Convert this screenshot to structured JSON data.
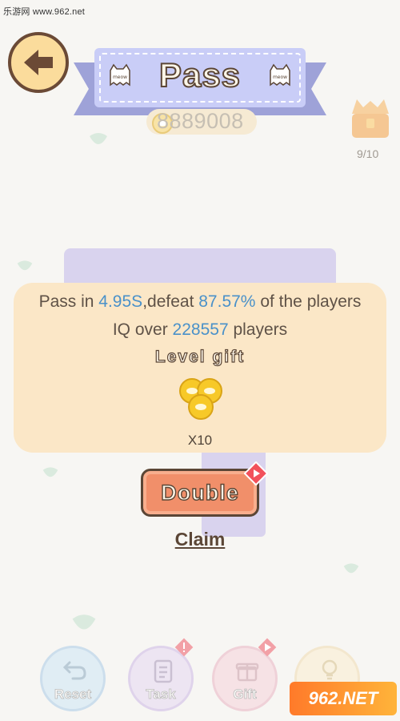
{
  "watermark": {
    "top_text": "乐游网 www.962.net",
    "bottom_text": "962.NET"
  },
  "header": {
    "back_icon": "back-arrow-icon",
    "title": "Pass",
    "coins": "8889008",
    "chest_progress": "9/10"
  },
  "result": {
    "line1_prefix": "Pass in ",
    "time": "4.95S",
    "line1_mid": ",defeat ",
    "percent": "87.57%",
    "line1_suffix": " of the players",
    "line2_prefix": "IQ over ",
    "iq_count": "228557",
    "line2_suffix": " players",
    "gift_title": "Level gift",
    "gift_quantity": "X10"
  },
  "actions": {
    "double_label": "Double",
    "claim_label": "Claim"
  },
  "bottom_bar": {
    "reset_label": "Reset",
    "task_label": "Task",
    "gift_label": "Gift"
  },
  "colors": {
    "background": "#f7f6f3",
    "panel": "#fbe7c7",
    "highlight_text": "#4a91c9",
    "banner": "#c9cdf7",
    "double_button": "#f18f6a",
    "outline": "#5b4636"
  }
}
